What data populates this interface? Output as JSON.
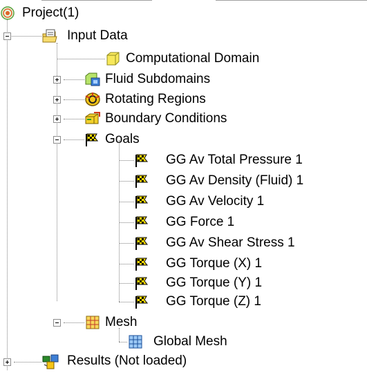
{
  "tree": {
    "root": {
      "label": "Project(1)",
      "icon": "project-target-icon"
    },
    "input_data": {
      "label": "Input Data",
      "icon": "input-data-folder-icon",
      "children": {
        "computational_domain": {
          "label": "Computational Domain",
          "icon": "computational-domain-icon"
        },
        "fluid_subdomains": {
          "label": "Fluid Subdomains",
          "icon": "fluid-subdomains-icon"
        },
        "rotating_regions": {
          "label": "Rotating Regions",
          "icon": "rotating-regions-icon"
        },
        "boundary_conditions": {
          "label": "Boundary Conditions",
          "icon": "boundary-conditions-icon"
        },
        "goals": {
          "label": "Goals",
          "icon": "checkered-flag-icon",
          "items": [
            {
              "label": "GG Av Total Pressure 1"
            },
            {
              "label": "GG Av Density (Fluid) 1"
            },
            {
              "label": "GG Av Velocity 1"
            },
            {
              "label": "GG Force 1"
            },
            {
              "label": "GG Av Shear Stress 1"
            },
            {
              "label": "GG Torque (X) 1"
            },
            {
              "label": "GG Torque (Y) 1"
            },
            {
              "label": "GG Torque (Z) 1"
            }
          ]
        },
        "mesh": {
          "label": "Mesh",
          "icon": "mesh-icon",
          "items": [
            {
              "label": "Global Mesh",
              "icon": "global-mesh-icon"
            }
          ]
        }
      }
    },
    "results": {
      "label": "Results (Not loaded)",
      "icon": "results-icon"
    }
  },
  "colors": {
    "flag_yellow": "#f5d800",
    "domain_yellow": "#f7e85a",
    "mesh_blue": "#3d7fd6",
    "tree_line": "#808080"
  }
}
